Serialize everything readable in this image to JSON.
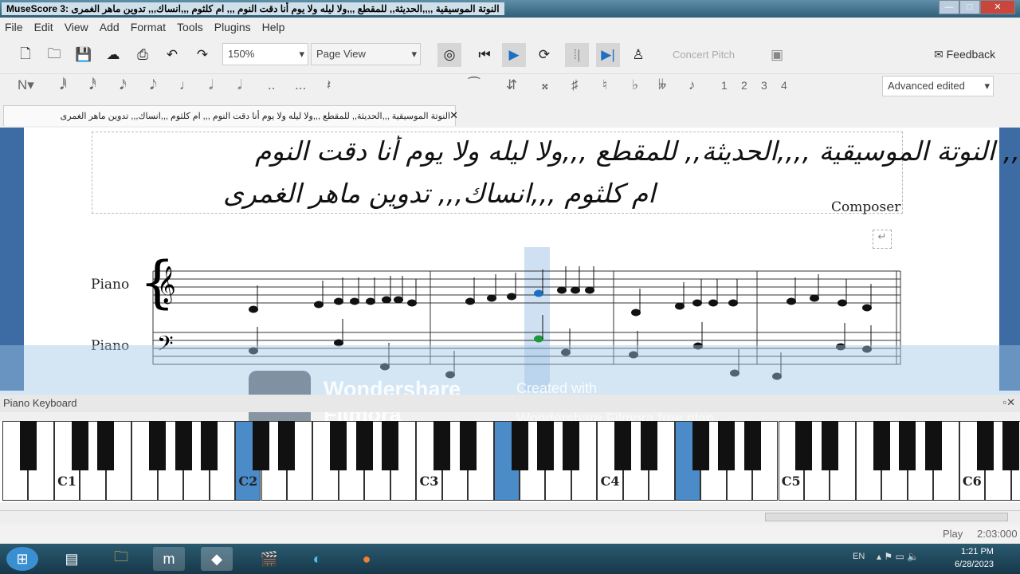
{
  "window": {
    "title": "MuseScore 3: النوتة الموسيقية ,,,,الحديثة,, للمقطع ,,,ولا ليله ولا يوم أنا دقت النوم ,,, ام كلثوم ,,,انساك,,, تدوين ماهر الغمرى"
  },
  "menu": [
    "File",
    "Edit",
    "View",
    "Add",
    "Format",
    "Tools",
    "Plugins",
    "Help"
  ],
  "toolbar": {
    "zoom": "150%",
    "view_mode": "Page View",
    "concert_pitch": "Concert Pitch",
    "feedback": "Feedback",
    "workspace": "Advanced edited",
    "voices": [
      "1",
      "2",
      "3",
      "4"
    ]
  },
  "tab": {
    "label": "النوتة الموسيقية ,,,الحديثة,, للمقطع ,,,ولا ليله ولا يوم أنا دقت النوم ,,, ام كلثوم ,,,انساك,,, تدوين ماهر الغمرى",
    "close": "✕"
  },
  "score": {
    "title_line1": ",, النوتة الموسيقية ,,,,الحديثة,, للمقطع ,,,ولا ليله ولا يوم أنا دقت النوم",
    "title_line2": "ام كلثوم ,,,انساك,,, تدوين ماهر الغمرى",
    "composer": "Composer",
    "staff1": "Piano",
    "staff2": "Piano"
  },
  "piano_keyboard": {
    "title": "Piano Keyboard",
    "labels": [
      "C1",
      "C2",
      "C3",
      "C4",
      "C5",
      "C6"
    ],
    "highlighted": [
      "C2",
      "F3",
      "F4"
    ]
  },
  "watermark": {
    "brand": "Wondershare",
    "product": "Filmora",
    "created": "Created with",
    "plan": "Wondershare Filmora free plan"
  },
  "status": {
    "mode": "Play",
    "time": "2:03:000"
  },
  "tray": {
    "lang": "EN",
    "time": "1:21 PM",
    "date": "6/28/2023"
  },
  "colors": {
    "accent": "#3d6ba3",
    "highlight": "#4a8bc8"
  }
}
